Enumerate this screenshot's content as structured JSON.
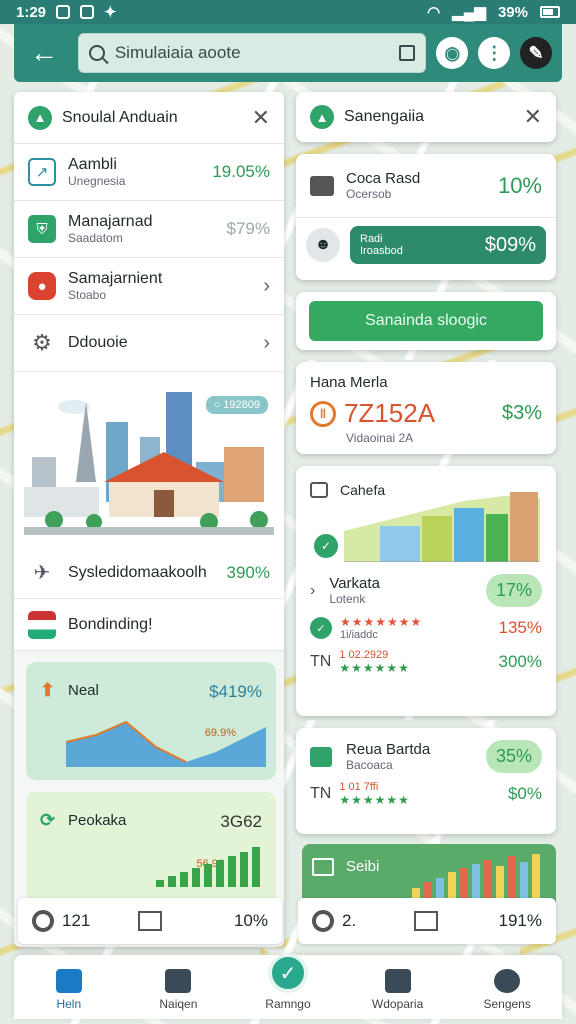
{
  "status_bar": {
    "time": "1:29",
    "battery": "39%"
  },
  "top_bar": {
    "search_placeholder": "Simulaiaia aoote"
  },
  "left_panel": {
    "title": "Snoulal Anduain",
    "rows": [
      {
        "title": "Aambli",
        "subtitle": "Unegnesia",
        "value": "19.05%"
      },
      {
        "title": "Manajarnad",
        "subtitle": "Saadatom",
        "value": "$79%"
      },
      {
        "title": "Samajarnient",
        "subtitle": "Stoabo"
      },
      {
        "title": "Ddouoie"
      }
    ],
    "city_badge": "○ 192809",
    "pct_rows": [
      {
        "title": "Sysledidomaakoolh",
        "value": "390%"
      },
      {
        "title": "Bondinding!"
      }
    ],
    "cards": [
      {
        "label": "Neal",
        "value": "$419%",
        "note": "69.9%"
      },
      {
        "label": "Peokaka",
        "value": "3G62",
        "note": "56.90"
      }
    ],
    "footer": {
      "count": "121",
      "pct": "10%"
    }
  },
  "right_panel": {
    "title": "Sanengaiia",
    "card1": {
      "title": "Coca Rasd",
      "subtitle": "Ocersob",
      "value": "10%"
    },
    "card1_pill": {
      "t1": "Radi",
      "t2": "Iroasbod",
      "value": "$09%"
    },
    "button": "Sanainda sloogic",
    "card2": {
      "title": "Hana Merla",
      "value": "7Z152A",
      "sub": "Vidaoinai 2A",
      "pct": "$3%"
    },
    "card3": {
      "title": "Cahefa"
    },
    "card4": {
      "title": "Varkata",
      "subtitle": "Lotenk",
      "value": "17%",
      "rows": [
        {
          "label": "1i/iaddc",
          "value": "135%"
        },
        {
          "label": "TN",
          "sub": "1 02.2929",
          "value": "300%"
        }
      ]
    },
    "card5": {
      "title": "Reua Bartda",
      "subtitle": "Bacoaca",
      "value": "35%",
      "row": {
        "label": "TN",
        "sub": "1 01 7ffi",
        "value": "$0%"
      }
    },
    "card6": {
      "title": "Seibi"
    },
    "footer": {
      "count": "2.",
      "pct": "191%"
    }
  },
  "bottom_nav": [
    {
      "label": "Heln"
    },
    {
      "label": "Naiqen"
    },
    {
      "label": "Ramngo"
    },
    {
      "label": "Wdoparia"
    },
    {
      "label": "Sengens"
    }
  ],
  "colors": {
    "brand": "#2e8b7b",
    "positive": "#2e9b55",
    "accent": "#e07a2a"
  }
}
